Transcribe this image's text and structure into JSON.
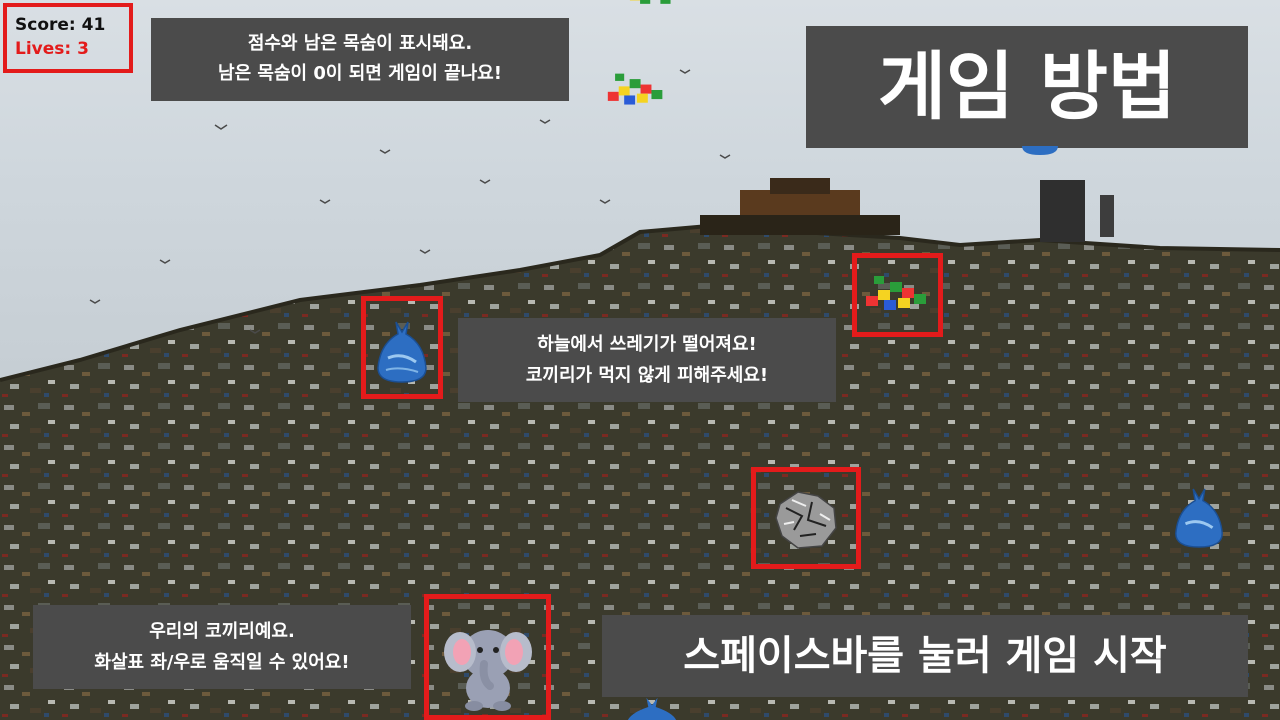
{
  "hud": {
    "score_label": "Score: 41",
    "lives_label": "Lives: 3",
    "lives_color": "#e31b1b"
  },
  "title": "게임 방법",
  "tips": {
    "score_tip": [
      "점수와 남은 목숨이 표시돼요.",
      "남은 목숨이 0이 되면 게임이 끝나요!"
    ],
    "falling_tip": [
      "하늘에서 쓰레기가 떨어져요!",
      "코끼리가 먹지 않게 피해주세요!"
    ],
    "elephant_tip": [
      "우리의 코끼리예요.",
      "화살표 좌/우로 움직일 수 있어요!"
    ]
  },
  "start_prompt": "스페이스바를 눌러 게임 시작",
  "sprites": {
    "trash_bag": "plastic-bag-icon",
    "blocks": "toy-blocks-icon",
    "foil": "crumpled-foil-icon",
    "player": "elephant-icon"
  },
  "colors": {
    "highlight": "#e31b1b",
    "panel": "#4b4b4b",
    "text": "#ffffff"
  }
}
